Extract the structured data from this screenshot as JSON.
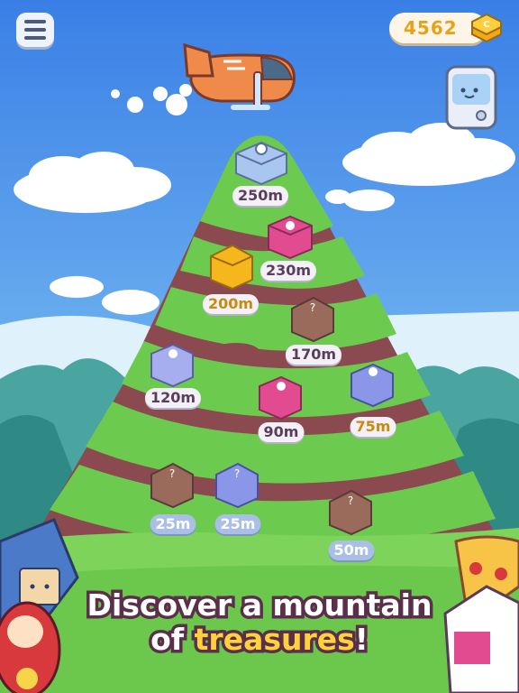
{
  "hud": {
    "coins": "4562"
  },
  "altitude_labels": [
    "250m",
    "230m",
    "200m",
    "170m",
    "120m",
    "90m",
    "75m",
    "25m",
    "25m",
    "50m"
  ],
  "headline": {
    "line1": "Discover a mountain",
    "line2_prefix": "of ",
    "line2_highlight": "treasures",
    "line2_suffix": "!"
  },
  "icons": {
    "menu": "hamburger-menu-icon",
    "coin": "gold-coin-stack-icon",
    "vending": "capsule-vending-machine-icon",
    "plane": "orange-airplane-icon"
  },
  "colors": {
    "sky_top": "#3f86e8",
    "sky_bottom": "#bfe2f7",
    "grass": "#6ccb4e",
    "dirt": "#8a4a50",
    "label_text": "#5a3f5a",
    "gold": "#e8a217",
    "outline": "#5a2f4a"
  }
}
